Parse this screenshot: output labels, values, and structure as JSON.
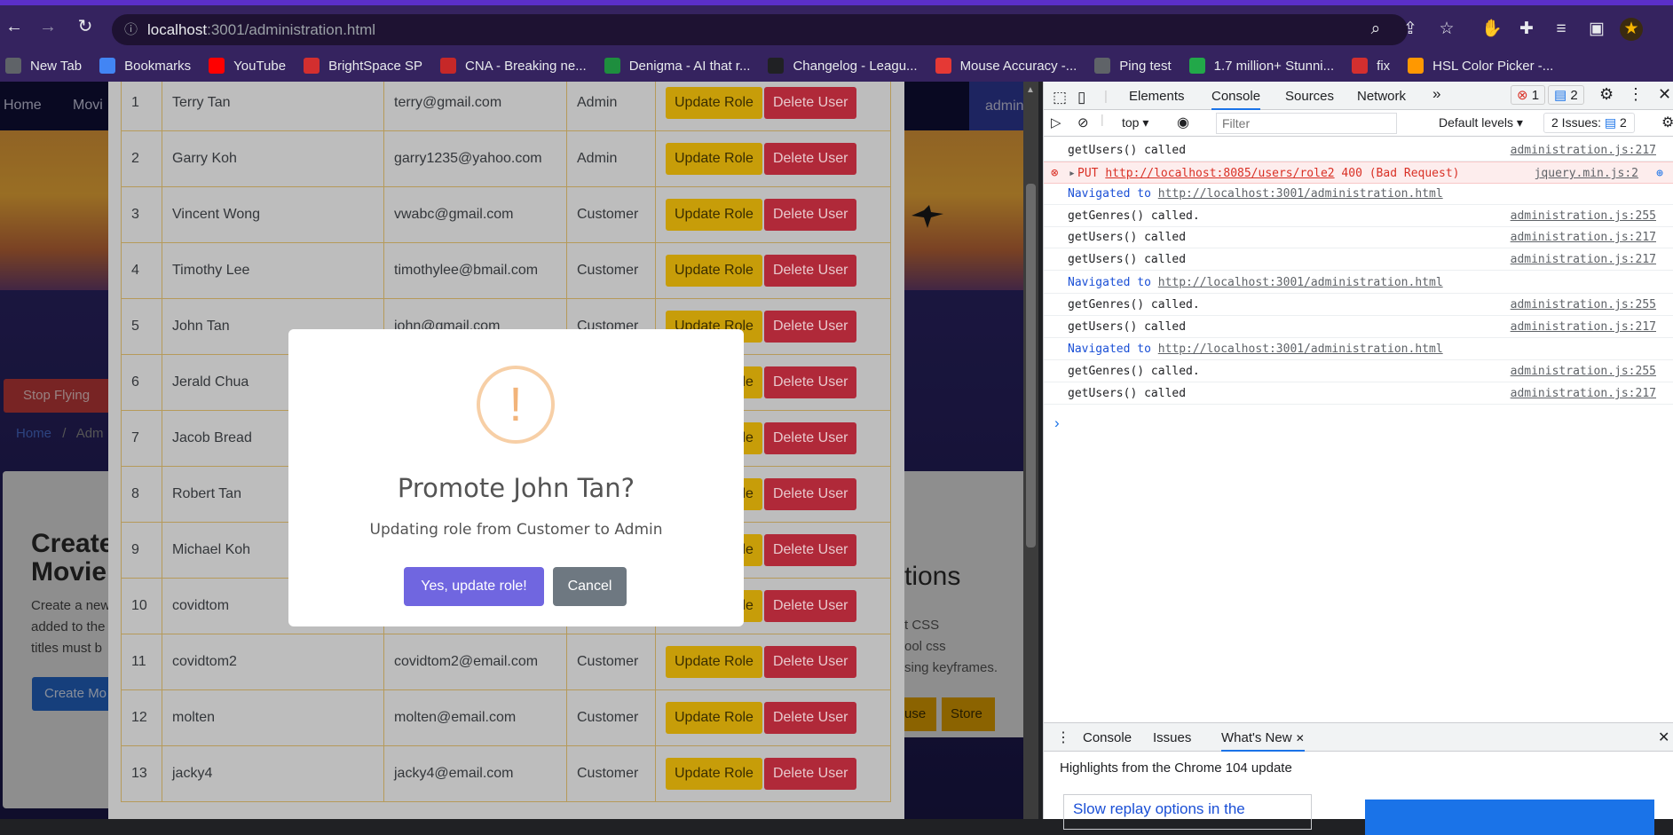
{
  "browser": {
    "url_host": "localhost",
    "url_rest": ":3001/administration.html",
    "bookmarks": [
      {
        "label": "New Tab",
        "color": "#5f6368"
      },
      {
        "label": "Bookmarks",
        "color": "#4285f4"
      },
      {
        "label": "YouTube",
        "color": "#ff0000"
      },
      {
        "label": "BrightSpace SP",
        "color": "#d32f2f"
      },
      {
        "label": "CNA - Breaking ne...",
        "color": "#c62828"
      },
      {
        "label": "Denigma - AI that r...",
        "color": "#1e8e3e"
      },
      {
        "label": "Changelog - Leagu...",
        "color": "#202124"
      },
      {
        "label": "Mouse Accuracy -...",
        "color": "#e53935"
      },
      {
        "label": "Ping test",
        "color": "#5f6368"
      },
      {
        "label": "1.7 million+ Stunni...",
        "color": "#22a849"
      },
      {
        "label": "fix",
        "color": "#d32f2f"
      },
      {
        "label": "HSL Color Picker -...",
        "color": "#ff9800"
      }
    ]
  },
  "page": {
    "users": [
      {
        "no": "1",
        "name": "Terry Tan",
        "email": "terry@gmail.com",
        "role": "Admin"
      },
      {
        "no": "2",
        "name": "Garry Koh",
        "email": "garry1235@yahoo.com",
        "role": "Admin"
      },
      {
        "no": "3",
        "name": "Vincent Wong",
        "email": "vwabc@gmail.com",
        "role": "Customer"
      },
      {
        "no": "4",
        "name": "Timothy Lee",
        "email": "timothylee@bmail.com",
        "role": "Customer"
      },
      {
        "no": "5",
        "name": "John Tan",
        "email": "john@gmail.com",
        "role": "Customer"
      },
      {
        "no": "6",
        "name": "Jerald Chua",
        "email": "",
        "role": ""
      },
      {
        "no": "7",
        "name": "Jacob Bread",
        "email": "",
        "role": ""
      },
      {
        "no": "8",
        "name": "Robert Tan",
        "email": "",
        "role": ""
      },
      {
        "no": "9",
        "name": "Michael Koh",
        "email": "",
        "role": ""
      },
      {
        "no": "10",
        "name": "covidtom",
        "email": "",
        "role": ""
      },
      {
        "no": "11",
        "name": "covidtom2",
        "email": "covidtom2@email.com",
        "role": "Customer"
      },
      {
        "no": "12",
        "name": "molten",
        "email": "molten@email.com",
        "role": "Customer"
      },
      {
        "no": "13",
        "name": "jacky4",
        "email": "jacky4@email.com",
        "role": "Customer"
      }
    ],
    "update_label": "Update Role",
    "delete_label": "Delete User",
    "bg": {
      "nav_home": "Home",
      "nav_movies": "Movi",
      "nav_admin": "admin",
      "stop_flying": "Stop Flying",
      "crumb_home": "Home",
      "crumb_sep": "/",
      "crumb_admin": "Adm",
      "create_title_1": "Create",
      "create_title_2": "Movie",
      "create_text_1": "Create a new",
      "create_text_2": "added to the",
      "create_text_3": "titles must b",
      "create_button": "Create Mo",
      "side_heading": "tions",
      "side_line_1": "t CSS",
      "side_line_2": "ool css",
      "side_line_3": "sing keyframes.",
      "pause_btn": "use",
      "store_btn": "Store"
    }
  },
  "modal": {
    "icon_glyph": "!",
    "title": "Promote John Tan?",
    "text": "Updating role from Customer to Admin",
    "confirm": "Yes, update role!",
    "cancel": "Cancel"
  },
  "devtools": {
    "tabs": [
      "Elements",
      "Console",
      "Sources",
      "Network"
    ],
    "more_tabs": "»",
    "errors_count": "1",
    "messages_count": "2",
    "context": "top",
    "filter_placeholder": "Filter",
    "levels": "Default levels",
    "issues_label": "2 Issues:",
    "issues_count": "2",
    "logs": [
      {
        "kind": "log",
        "text": "getUsers() called",
        "src": "administration.js:217"
      },
      {
        "kind": "error",
        "text": "PUT",
        "url": "http://localhost:8085/users/role2",
        "status": "400 (Bad Request)",
        "src": "jquery.min.js:2"
      },
      {
        "kind": "nav",
        "text": "Navigated to",
        "url": "http://localhost:3001/administration.html"
      },
      {
        "kind": "log",
        "text": "getGenres() called.",
        "src": "administration.js:255"
      },
      {
        "kind": "log",
        "text": "getUsers() called",
        "src": "administration.js:217"
      },
      {
        "kind": "log",
        "text": "getUsers() called",
        "src": "administration.js:217"
      },
      {
        "kind": "nav",
        "text": "Navigated to",
        "url": "http://localhost:3001/administration.html"
      },
      {
        "kind": "log",
        "text": "getGenres() called.",
        "src": "administration.js:255"
      },
      {
        "kind": "log",
        "text": "getUsers() called",
        "src": "administration.js:217"
      },
      {
        "kind": "nav",
        "text": "Navigated to",
        "url": "http://localhost:3001/administration.html"
      },
      {
        "kind": "log",
        "text": "getGenres() called.",
        "src": "administration.js:255"
      },
      {
        "kind": "log",
        "text": "getUsers() called",
        "src": "administration.js:217"
      }
    ],
    "prompt": "›",
    "drawer_tabs": [
      "Console",
      "Issues",
      "What's New"
    ],
    "close_glyph": "✕",
    "whats_new_heading": "Highlights from the Chrome 104 update",
    "replay_text": "Slow replay options in the"
  }
}
